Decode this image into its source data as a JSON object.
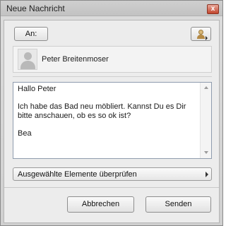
{
  "window": {
    "title": "Neue Nachricht",
    "close_glyph": "x"
  },
  "toolbar": {
    "to_label": "An:",
    "address_book_icon": "address-book-icon"
  },
  "recipient": {
    "name": "Peter Breitenmoser",
    "avatar_icon": "person-placeholder-icon"
  },
  "message": {
    "body": "Hallo Peter\n\nIch habe das Bad neu möbliert. Kannst Du es Dir bitte anschauen, ob es so ok ist?\n\nBea"
  },
  "check_items": {
    "label": "Ausgewählte Elemente überprüfen"
  },
  "actions": {
    "cancel_label": "Abbrechen",
    "send_label": "Senden"
  },
  "colors": {
    "close_button": "#c2452d",
    "message_border": "#8f9cae"
  }
}
